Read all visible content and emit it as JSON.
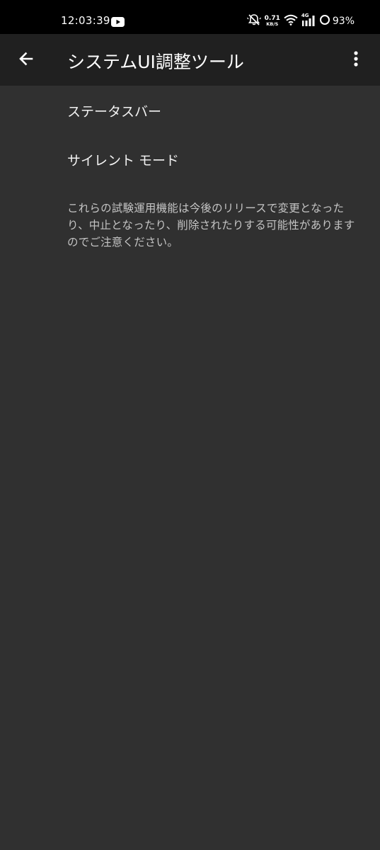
{
  "status_bar": {
    "time": "12:03:39",
    "net_speed_value": "0.71",
    "net_speed_unit": "KB/S",
    "network_type": "4G",
    "battery_percent": "93%",
    "icons": [
      "youtube-icon",
      "muted-bell-icon",
      "wifi-icon",
      "signal-icon",
      "battery-ring-icon"
    ]
  },
  "app_bar": {
    "title": "システムUI調整ツール",
    "back_icon": "arrow-back-icon",
    "overflow_icon": "more-vert-icon"
  },
  "items": [
    {
      "label": "ステータスバー"
    },
    {
      "label": "サイレント モード"
    }
  ],
  "footer_note": "これらの試験運用機能は今後のリリースで変更となったり、中止となったり、削除されたりする可能性がありますのでご注意ください。",
  "colors": {
    "background": "#303030",
    "app_bar": "#202020",
    "status_bar": "#000000",
    "text_primary": "#f2f2f2",
    "text_secondary": "#c4c4c4"
  }
}
